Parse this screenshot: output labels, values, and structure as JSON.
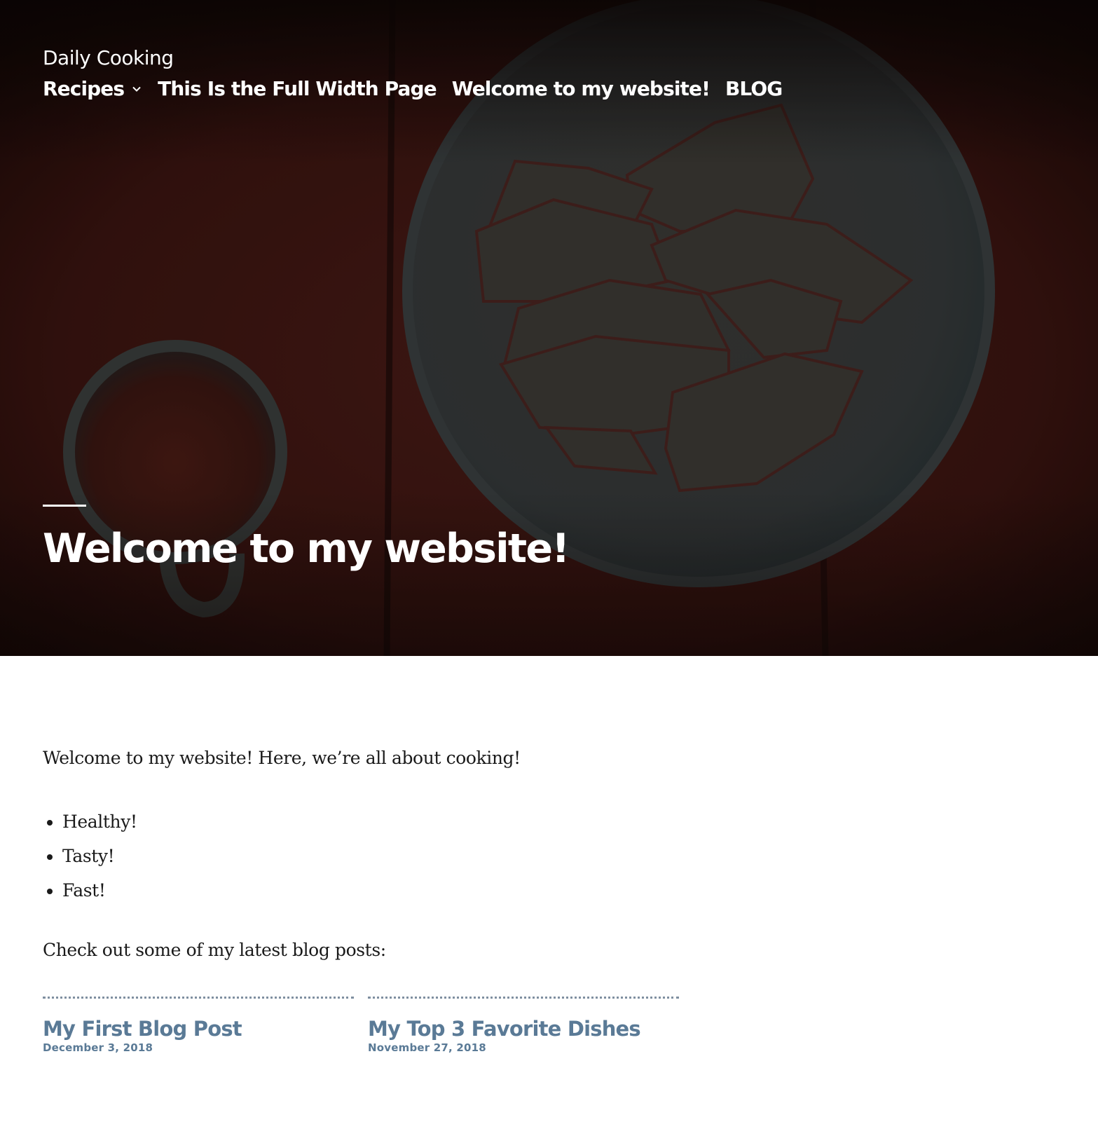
{
  "site": {
    "title": "Daily Cooking"
  },
  "nav": {
    "items": [
      {
        "label": "Recipes",
        "has_submenu": true
      },
      {
        "label": "This Is the Full Width Page"
      },
      {
        "label": "Welcome to my website!"
      },
      {
        "label": "BLOG"
      }
    ]
  },
  "hero": {
    "title": "Welcome to my website!"
  },
  "content": {
    "intro": "Welcome to my website! Here, we’re all about cooking!",
    "features": [
      "Healthy!",
      "Tasty!",
      "Fast!"
    ],
    "latest_text": "Check out some of my latest blog posts:"
  },
  "posts": [
    {
      "title": "My First Blog Post",
      "date": "December 3, 2018"
    },
    {
      "title": "My Top 3 Favorite Dishes",
      "date": "November 27, 2018"
    }
  ],
  "colors": {
    "link": "#5a7a96",
    "text": "#1a1a1a",
    "hero_bg": "#2a0f0c"
  }
}
